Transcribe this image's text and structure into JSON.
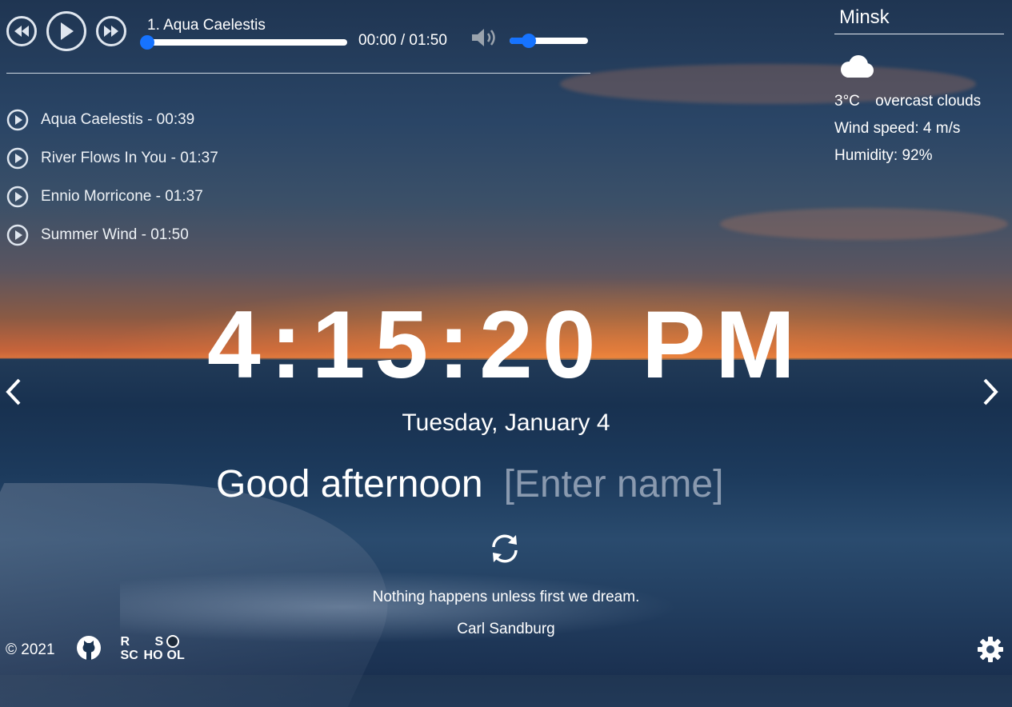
{
  "player": {
    "track_title": "1. Aqua Caelestis",
    "time_display": "00:00 / 01:50",
    "progress": 0,
    "volume": 0.25,
    "icons": [
      "rewind-icon",
      "play-icon",
      "fast-forward-icon",
      "volume-icon"
    ]
  },
  "playlist": [
    {
      "label": "Aqua Caelestis - 00:39"
    },
    {
      "label": "River Flows In You - 01:37"
    },
    {
      "label": "Ennio Morricone - 01:37"
    },
    {
      "label": "Summer Wind - 01:50"
    }
  ],
  "weather": {
    "city": "Minsk",
    "icon": "cloud-icon",
    "temperature": "3°C",
    "description": "overcast clouds",
    "wind": "Wind speed: 4 m/s",
    "humidity": "Humidity: 92%"
  },
  "clock": {
    "time": "4:15:20 PM",
    "date": "Tuesday, January 4"
  },
  "greeting": {
    "text": "Good afternoon",
    "name_placeholder": "[Enter name]"
  },
  "quote": {
    "text": "Nothing happens unless first we dream.",
    "author": "Carl Sandburg"
  },
  "footer": {
    "copyright": "© 2021",
    "school_logo_letters": [
      "R",
      "S",
      "SC",
      "HO",
      "OL"
    ]
  },
  "colors": {
    "accent": "#1673ff"
  }
}
